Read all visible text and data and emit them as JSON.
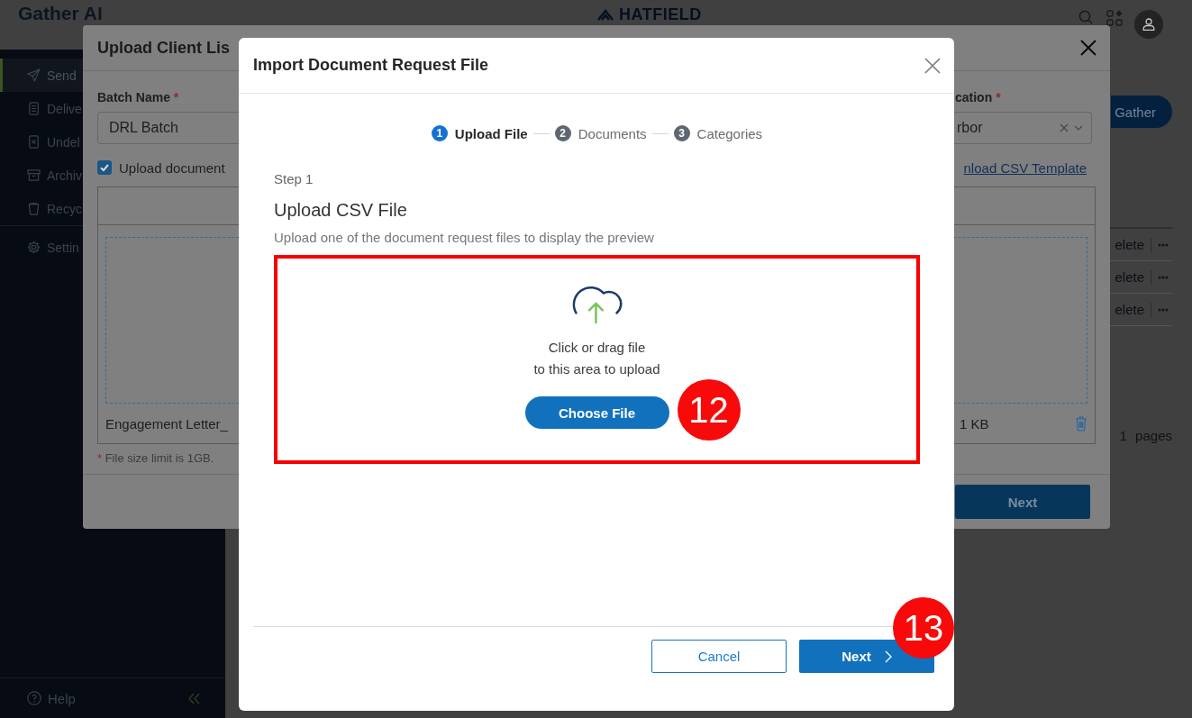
{
  "topbar": {
    "logo": "Gather AI",
    "brand": "HATFIELD"
  },
  "sidebar": {
    "sections": [
      {
        "items": [
          {
            "label": "Send",
            "selected": true
          },
          {
            "label": "Delive",
            "selected": false
          },
          {
            "label": "Undel",
            "selected": false
          },
          {
            "label": "Archiv",
            "selected": false
          },
          {
            "label": "Recyc",
            "selected": false
          }
        ]
      },
      {
        "items": [
          {
            "label": "Settin",
            "selected": false
          }
        ]
      }
    ],
    "help": "Help"
  },
  "main": {
    "action_button": "Gather",
    "rows": [
      {
        "action": "elete"
      },
      {
        "action": "elete"
      },
      {
        "action": "elete"
      }
    ],
    "pagination": "1 pages"
  },
  "upload_dialog": {
    "title": "Upload Client Lis",
    "fields": [
      {
        "kind": "input",
        "label": "Batch Name",
        "required_mark": "*",
        "value": "DRL Batch"
      },
      {
        "kind": "select",
        "label": "cation",
        "required_mark": "*",
        "value": "rbor"
      }
    ],
    "checkbox": {
      "label": "Upload document",
      "checked": true
    },
    "template_link": "nload CSV Template",
    "file": {
      "name": "Engagement Letter_",
      "size": "1 KB"
    },
    "note_mark": "*",
    "note": "File size limit is 1GB.",
    "next_button": "Next"
  },
  "import_dialog": {
    "title": "Import Document Request File",
    "steps": [
      {
        "number": "1",
        "label": "Upload File",
        "selected": true
      },
      {
        "number": "2",
        "label": "Documents",
        "selected": false
      },
      {
        "number": "3",
        "label": "Categories",
        "selected": false
      }
    ],
    "step_caption": "Step 1",
    "heading": "Upload CSV File",
    "description": "Upload one of the document request files to display the preview",
    "dropzone": {
      "highlighted": true,
      "lines": [
        "Click or drag file",
        "to this area to upload"
      ],
      "button": "Choose File",
      "callout": "12"
    },
    "buttons": [
      {
        "kind": "outlined",
        "label": "Cancel"
      },
      {
        "kind": "filled",
        "label": "Next",
        "callout": "13"
      }
    ]
  }
}
